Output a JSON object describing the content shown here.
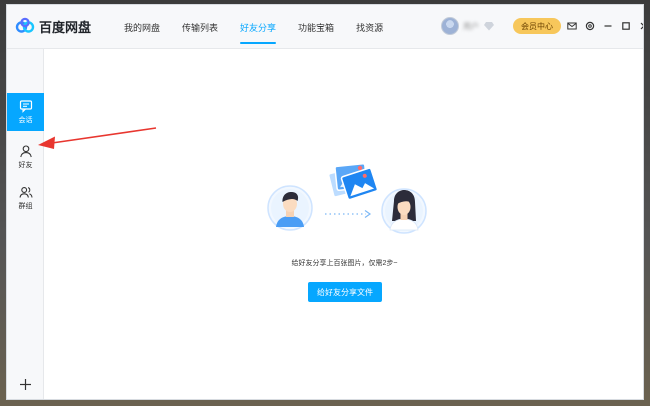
{
  "app": {
    "name": "百度网盘"
  },
  "nav": {
    "tabs": [
      {
        "label": "我的网盘"
      },
      {
        "label": "传输列表"
      },
      {
        "label": "好友分享"
      },
      {
        "label": "功能宝箱"
      },
      {
        "label": "找资源"
      }
    ],
    "active_index": 2
  },
  "user": {
    "name": "用户",
    "vip_label": "会员中心"
  },
  "sidebar": {
    "items": [
      {
        "label": "会话",
        "icon": "chat-icon"
      },
      {
        "label": "好友",
        "icon": "person-icon"
      },
      {
        "label": "群组",
        "icon": "group-icon"
      }
    ],
    "active_index": 0
  },
  "main": {
    "hint": "给好友分享上百张图片，仅需2步~",
    "share_button": "给好友分享文件"
  },
  "colors": {
    "accent": "#06a7ff",
    "vip": "#f7c75b",
    "annotation": "#e8362f"
  }
}
